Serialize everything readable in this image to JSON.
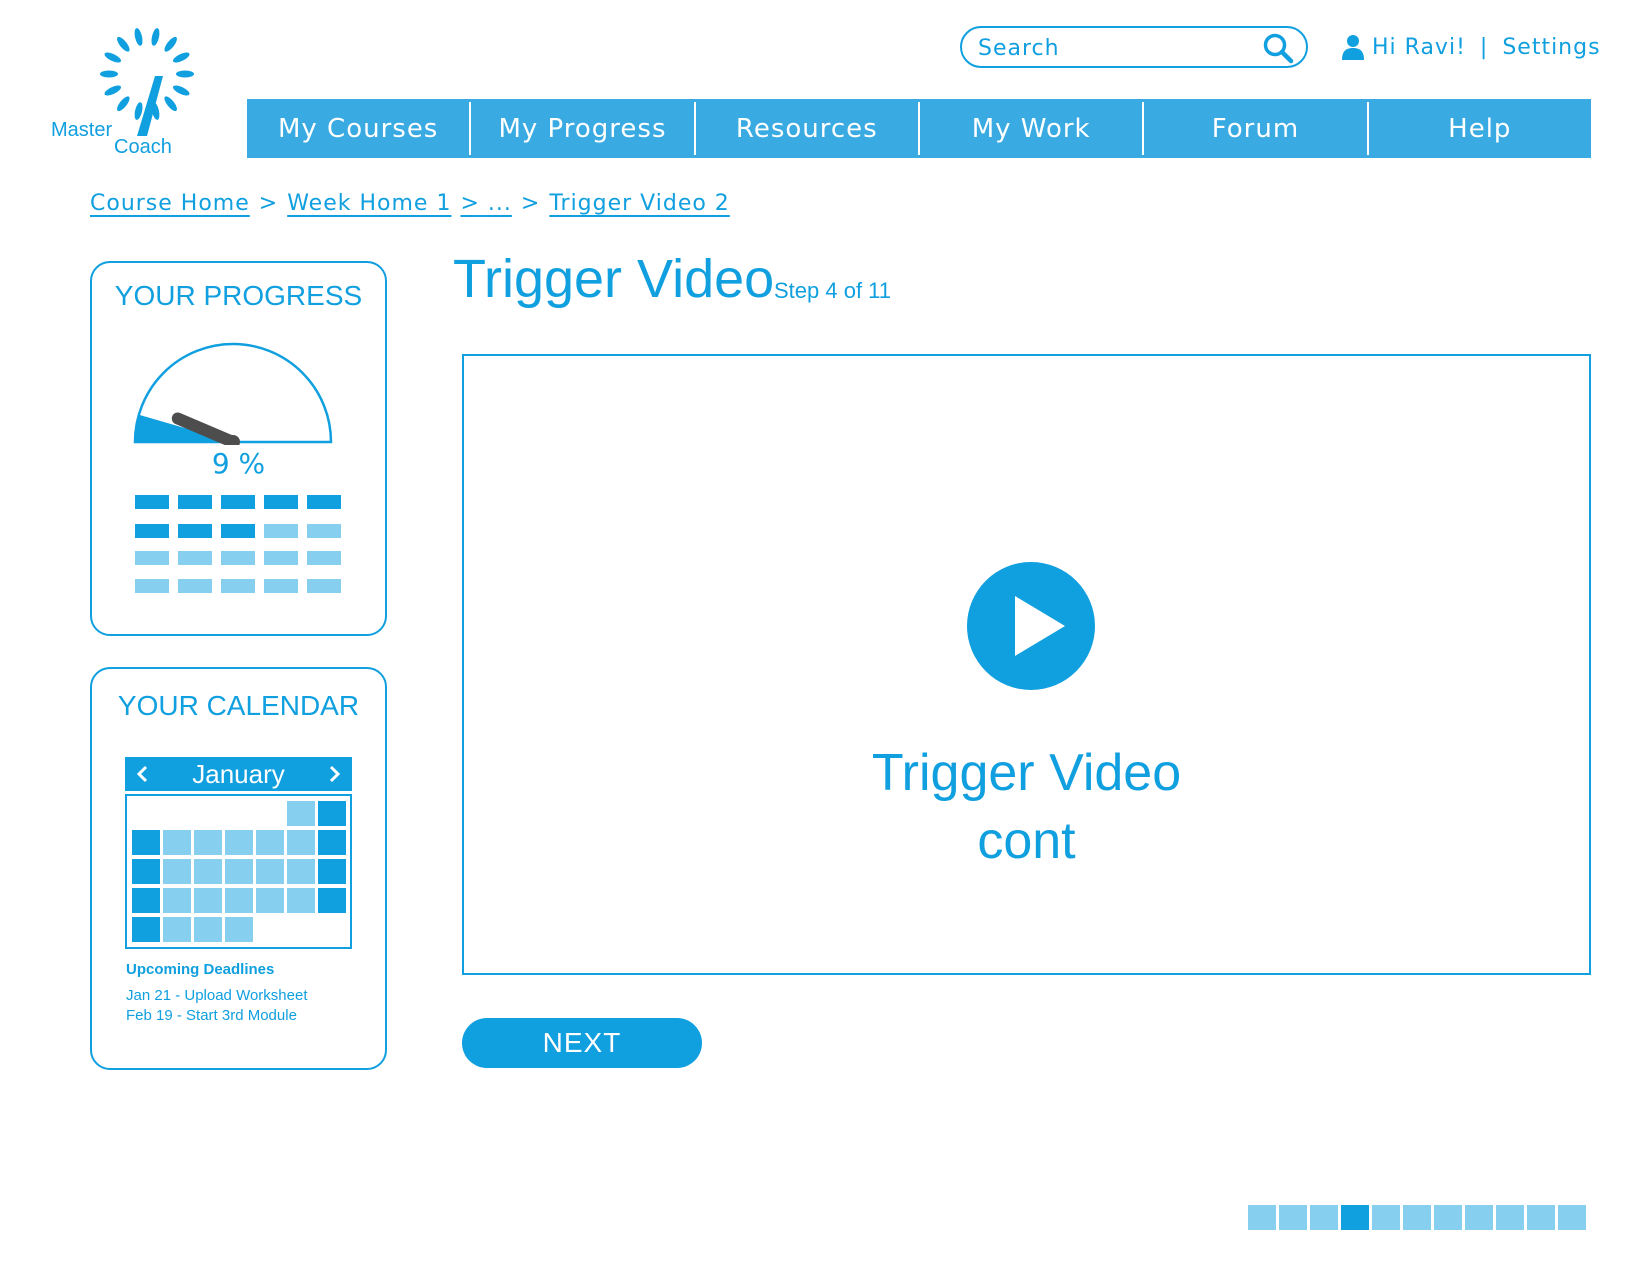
{
  "colors": {
    "primary": "#109fdf",
    "nav_bg": "#39aae2",
    "light": "#86cfee",
    "needle": "#4d4d4d"
  },
  "logo": {
    "line1": "Master",
    "line2": "Coach"
  },
  "search": {
    "placeholder": "Search",
    "icon": "search-icon"
  },
  "user": {
    "greeting": "Hi Ravi!",
    "separator": "|",
    "settings": "Settings",
    "icon": "user-icon"
  },
  "nav": {
    "items": [
      {
        "label": "My Courses"
      },
      {
        "label": "My Progress"
      },
      {
        "label": "Resources"
      },
      {
        "label": "My Work"
      },
      {
        "label": "Forum"
      },
      {
        "label": "Help"
      }
    ]
  },
  "breadcrumb": {
    "items": [
      {
        "label": "Course Home"
      },
      {
        "label": "Week Home 1"
      },
      {
        "label": "..."
      },
      {
        "label": "Trigger Video 2"
      }
    ],
    "separator": ">"
  },
  "progress": {
    "title": "YOUR PROGRESS",
    "percent_label": "9 %",
    "percent": 9,
    "blocks_total": 20,
    "blocks_done": 8
  },
  "calendar": {
    "title": "YOUR CALENDAR",
    "month": "January",
    "deadlines_title": "Upcoming Deadlines",
    "deadlines": [
      "Jan 21 - Upload Worksheet",
      "Feb 19 - Start 3rd Module"
    ]
  },
  "main": {
    "title": "Trigger Video",
    "step_text": "Step 4 of 11",
    "video_caption_line1": "Trigger Video",
    "video_caption_line2": "cont",
    "next_label": "NEXT"
  },
  "steps": {
    "total": 11,
    "current": 4
  }
}
